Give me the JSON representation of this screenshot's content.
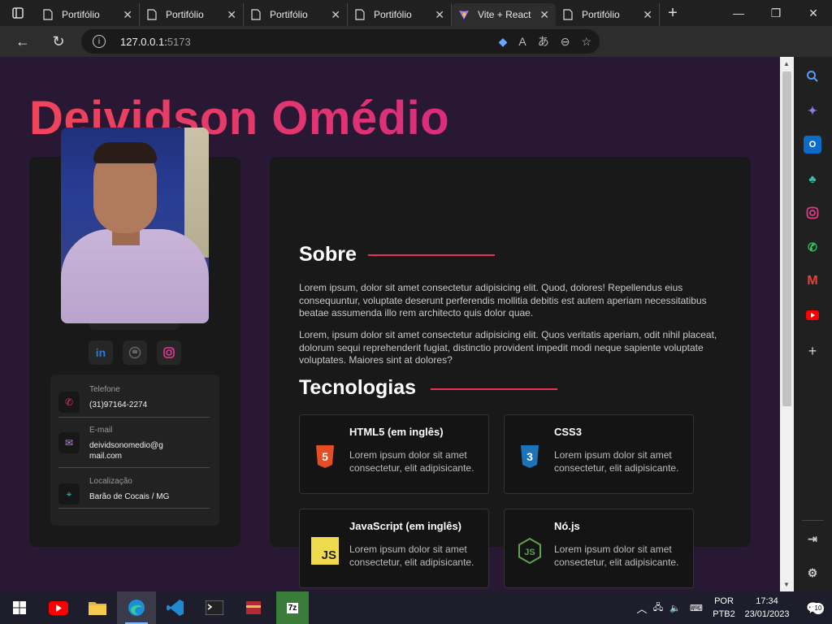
{
  "browser": {
    "tabs": [
      {
        "title": "Portifólio",
        "active": false
      },
      {
        "title": "Portifólio",
        "active": false
      },
      {
        "title": "Portifólio",
        "active": false
      },
      {
        "title": "Portifólio",
        "active": false
      },
      {
        "title": "Vite + React",
        "active": true
      },
      {
        "title": "Portifólio",
        "active": false
      }
    ],
    "url_host": "127.0.0.1:",
    "url_port": "5173"
  },
  "page": {
    "name": "Deividson Omédio",
    "social": [
      "linkedin",
      "github",
      "instagram"
    ],
    "contacts": [
      {
        "label": "Telefone",
        "value": "(31)97164-2274",
        "icon": "phone-icon"
      },
      {
        "label": "E-mail",
        "value": "deividsonomedio@gmail.com",
        "icon": "mail-icon"
      },
      {
        "label": "Localização",
        "value": "Barão de Cocais / MG",
        "icon": "location-icon"
      }
    ],
    "about": {
      "title": "Sobre",
      "paragraphs": [
        "Lorem ipsum, dolor sit amet consectetur adipisicing elit. Quod, dolores! Repellendus eius consequuntur, voluptate deserunt perferendis mollitia debitis est autem aperiam necessitatibus beatae assumenda illo rem architecto quis dolor quae.",
        "Lorem, ipsum dolor sit amet consectetur adipisicing elit. Quos veritatis aperiam, odit nihil placeat, dolorum sequi reprehenderit fugiat, distinctio provident impedit modi neque sapiente voluptate voluptates. Maiores sint at dolores?"
      ]
    },
    "tech": {
      "title": "Tecnologias",
      "items": [
        {
          "name": "HTML5 (em inglês)",
          "desc": "Lorem ipsum dolor sit amet consectetur, elit adipisicante.",
          "icon": "html5-icon",
          "glyph": "5"
        },
        {
          "name": "CSS3",
          "desc": "Lorem ipsum dolor sit amet consectetur, elit adipisicante.",
          "icon": "css3-icon",
          "glyph": "3"
        },
        {
          "name": "JavaScript (em inglês)",
          "desc": "Lorem ipsum dolor sit amet consectetur, elit adipisicante.",
          "icon": "javascript-icon",
          "glyph": "JS"
        },
        {
          "name": "Nó.js",
          "desc": "Lorem ipsum dolor sit amet consectetur, elit adipisicante.",
          "icon": "nodejs-icon",
          "glyph": "JS"
        }
      ]
    }
  },
  "taskbar": {
    "lang": "POR",
    "layout": "PTB2",
    "time": "17:34",
    "date": "23/01/2023",
    "notif_count": "10"
  },
  "colors": {
    "accent": "#e8325a",
    "page_bg": "#281833",
    "card_bg": "#191919"
  }
}
